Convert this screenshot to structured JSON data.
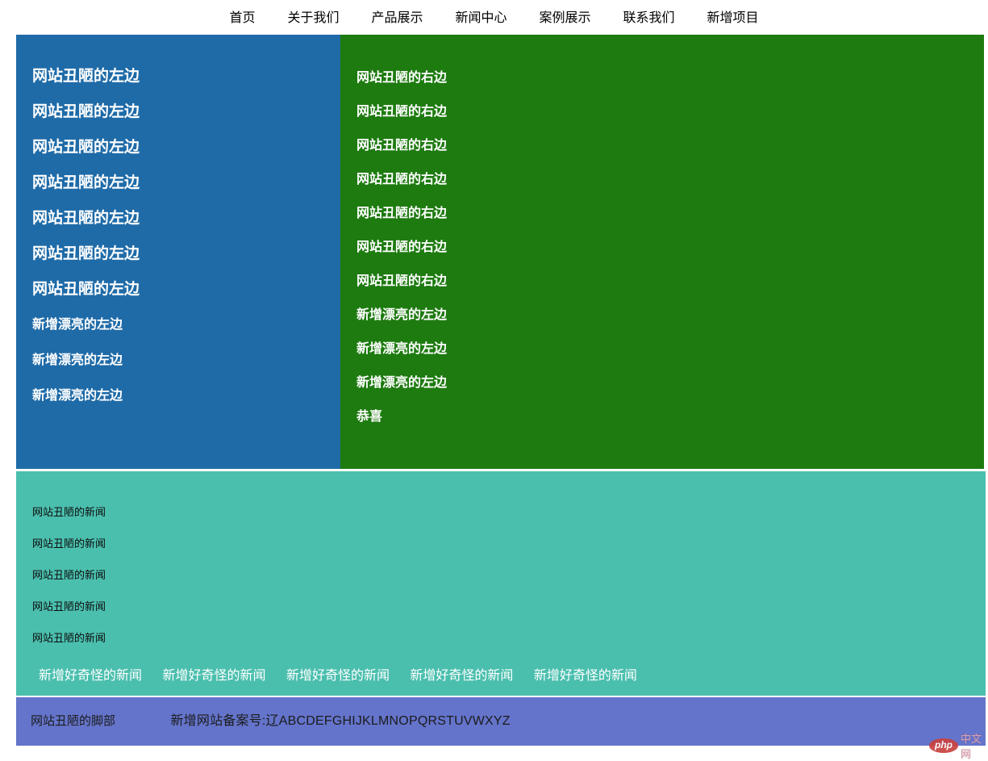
{
  "nav": {
    "items": [
      "首页",
      "关于我们",
      "产品展示",
      "新闻中心",
      "案例展示",
      "联系我们",
      "新增项目"
    ]
  },
  "colors": {
    "left_bg": "#1f6ba8",
    "right_bg": "#1e7b10",
    "news_bg": "#4bbfae",
    "footer_bg": "#6474cb",
    "watermark_red": "#c9423f"
  },
  "left_panel": {
    "ugly_items": [
      "网站丑陋的左边",
      "网站丑陋的左边",
      "网站丑陋的左边",
      "网站丑陋的左边",
      "网站丑陋的左边",
      "网站丑陋的左边",
      "网站丑陋的左边"
    ],
    "pretty_items": [
      "新增漂亮的左边",
      "新增漂亮的左边",
      "新增漂亮的左边"
    ]
  },
  "right_panel": {
    "ugly_items": [
      "网站丑陋的右边",
      "网站丑陋的右边",
      "网站丑陋的右边",
      "网站丑陋的右边",
      "网站丑陋的右边",
      "网站丑陋的右边",
      "网站丑陋的右边"
    ],
    "pretty_items": [
      "新增漂亮的左边",
      "新增漂亮的左边",
      "新增漂亮的左边"
    ],
    "congrats": "恭喜"
  },
  "news": {
    "ugly_news": [
      "网站丑陋的新闻",
      "网站丑陋的新闻",
      "网站丑陋的新闻",
      "网站丑陋的新闻",
      "网站丑陋的新闻"
    ],
    "strange_news": [
      "新增好奇怪的新闻",
      "新增好奇怪的新闻",
      "新增好奇怪的新闻",
      "新增好奇怪的新闻",
      "新增好奇怪的新闻"
    ]
  },
  "footer": {
    "label": "网站丑陋的脚部",
    "beian": "新增网站备案号:辽ABCDEFGHIJKLMNOPQRSTUVWXYZ"
  },
  "watermark": {
    "logo": "php",
    "text": "中文网"
  }
}
